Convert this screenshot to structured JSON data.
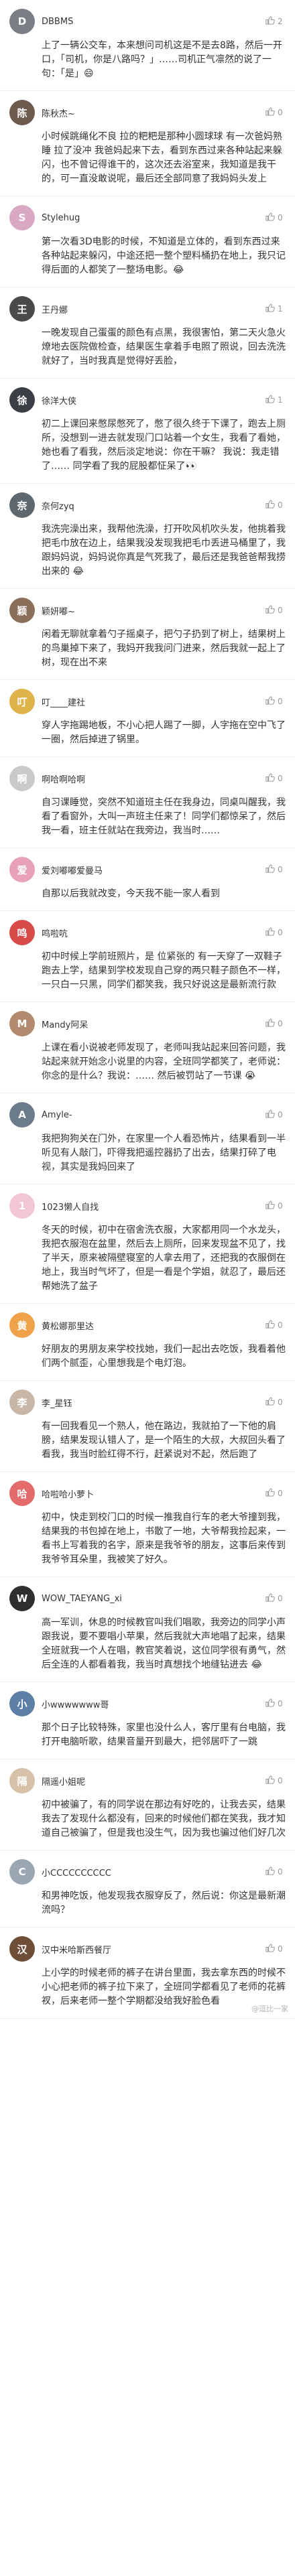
{
  "comments": [
    {
      "username": "DBBMS",
      "likes": "2",
      "avatar_color": "#7a7f86",
      "avatar_glyph": "D",
      "text": "上了一辆公交车，本来想问司机这是不是去8路，然后一开口，「司机，你是八路吗？」……司机正气凛然的说了一句：「是」😄"
    },
    {
      "username": "陈秋杰~",
      "likes": "0",
      "avatar_color": "#6d5a4c",
      "avatar_glyph": "陈",
      "text": "小时候跳绳化不良 拉的粑粑是那种小圆球球 有一次爸妈熟睡 拉了没冲 我爸妈起来下去，看到东西过来各种站起来躲闪，也不曾记得谁干的，这次还去浴室来，我知道是我干的，可一直没敢说呢，最后还全部同意了我妈妈头发上"
    },
    {
      "username": "Stylehug",
      "likes": "0",
      "avatar_color": "#d9a9c4",
      "avatar_glyph": "S",
      "text": "第一次看3D电影的时候，不知道是立体的，看到东西过来各种站起来躲闪，中途还把一整个塑料桶扔在地上，我只记得后面的人都笑了一整场电影。😂"
    },
    {
      "username": "王丹娜",
      "likes": "1",
      "avatar_color": "#4a4a4a",
      "avatar_glyph": "王",
      "text": "一晚发现自己蛋蛋的颜色有点黑，我很害怕，第二天火急火燎地去医院做检查，结果医生拿着手电照了照说，回去洗洗就好了，当时我真是觉得好丢脸，"
    },
    {
      "username": "徐洋大侠",
      "likes": "1",
      "avatar_color": "#3b3f45",
      "avatar_glyph": "徐",
      "text": "初二上课回来憋尿憋死了，憋了很久终于下课了，跑去上厕所，没想到一进去就发现门口站着一个女生，我看了看她，她也看了看我，然后淡定地说：你在干嘛？ 我说：我走错了…… 同学看了我的屁股都怔呆了👀"
    },
    {
      "username": "奈何zyq",
      "likes": "0",
      "avatar_color": "#5d6770",
      "avatar_glyph": "奈",
      "text": "我洗完澡出来，我帮他洗澡，打开吹风机吹头发，他挑着我把毛巾放在边上，结果我没发现我把毛巾丢进马桶里了，我跟妈妈说，妈妈说你真是气死我了，最后还是我爸爸帮我捞出来的 😂"
    },
    {
      "username": "颖妍嘟~",
      "likes": "0",
      "avatar_color": "#8c6f5a",
      "avatar_glyph": "颖",
      "text": "闲着无聊就拿着勺子摇桌子，把勺子扔到了树上，结果树上的鸟巢掉下来了，我妈开我我问门进来，然后我就一起上了树，现在出不来"
    },
    {
      "username": "叮____建社",
      "likes": "0",
      "avatar_color": "#e0b24a",
      "avatar_glyph": "叮",
      "text": "穿人字拖踢地板，不小心把人踢了一脚，人字拖在空中飞了一圈，然后掉进了锅里。"
    },
    {
      "username": "啊哈啊哈啊",
      "likes": "0",
      "avatar_color": "#c9c9c9",
      "avatar_glyph": "啊",
      "text": "自习课睡觉，突然不知道班主任在我身边，同桌叫醒我，我看了看窗外，大叫一声班主任来了！同学们都惊呆了，然后我一看，班主任就站在我旁边，我当时……"
    },
    {
      "username": "爱刘嘟嘟爱曼马",
      "likes": "0",
      "avatar_color": "#e8a2b8",
      "avatar_glyph": "爱",
      "text": "自那以后我就改变，今天我不能一家人看到"
    },
    {
      "username": "鸣啦吭",
      "likes": "0",
      "avatar_color": "#d84a4a",
      "avatar_glyph": "鸣",
      "text": "初中时候上学前班照片，是 位紧张的 有一天穿了一双鞋子跑去上学，结果到学校发现自己穿的两只鞋子颜色不一样，一只白一只黑，同学们都笑我，我只好说这是最新流行款"
    },
    {
      "username": "Mandy阿呆",
      "likes": "0",
      "avatar_color": "#b28b6e",
      "avatar_glyph": "M",
      "text": "上课在看小说被老师发现了，老师叫我站起来回答问题，我站起来就开始念小说里的内容，全班同学都笑了，老师说：你念的是什么？我说：…… 然后被罚站了一节课 😭"
    },
    {
      "username": "Amyle-",
      "likes": "0",
      "avatar_color": "#6b7b8c",
      "avatar_glyph": "A",
      "text": "我把狗狗关在门外，在家里一个人看恐怖片，结果看到一半听见有人敲门，吓得我把遥控器扔了出去，结果打碎了电视，其实是我妈回来了"
    },
    {
      "username": "1023懒人自找",
      "likes": "0",
      "avatar_color": "#f2c6d4",
      "avatar_glyph": "1",
      "text": "冬天的时候，初中在宿舍洗衣服，大家都用同一个水龙头，我把衣服泡在盆里，然后去上厕所，回来发现盆不见了，找了半天，原来被隔壁寝室的人拿去用了，还把我的衣服倒在地上，我当时气坏了，但是一看是个学姐，就忍了，最后还帮她洗了盆子"
    },
    {
      "username": "黄松娜那里达",
      "likes": "0",
      "avatar_color": "#f0a24a",
      "avatar_glyph": "黄",
      "text": "好朋友的男朋友来学校找她，我们一起出去吃饭，我看着他们两个腻歪，心里想我是个电灯泡。"
    },
    {
      "username": "李_星钰",
      "likes": "0",
      "avatar_color": "#c8b7a6",
      "avatar_glyph": "李",
      "text": "有一回我看见一个熟人，他在路边，我就拍了一下他的肩膀，结果发现认错人了，是一个陌生的大叔，大叔回头看了看我，我当时脸红得不行，赶紧说对不起，然后跑了"
    },
    {
      "username": "哈啦哈小萝卜",
      "likes": "0",
      "avatar_color": "#e36b6b",
      "avatar_glyph": "哈",
      "text": "初中，快走到校门口的时候一推我自行车的老大爷撞到我，结果我的书包掉在地上，书散了一地，大爷帮我捡起来，一看书上写着我的名字，原来是我爷爷的朋友，这事后来传到我爷爷耳朵里，我被笑了好久。"
    },
    {
      "username": "WOW_TAEYANG_xi",
      "likes": "0",
      "avatar_color": "#2f2f2f",
      "avatar_glyph": "W",
      "text": "高一军训，休息的时候教官叫我们唱歌，我旁边的同学小声跟我说，要不要唱小苹果，然后我就大声地唱了起来，结果全班就我一个人在唱，教官笑着说，这位同学很有勇气，然后全连的人都看着我，我当时真想找个地缝钻进去 😂"
    },
    {
      "username": "小wwwwwww哥",
      "likes": "0",
      "avatar_color": "#5b7fa6",
      "avatar_glyph": "小",
      "text": "那个日子比较特殊，家里也没什么人，客厅里有台电脑，我打开电脑听歌，结果音量开到最大，把邻居吓了一跳"
    },
    {
      "username": "隔遥小姐呢",
      "likes": "0",
      "avatar_color": "#d7c1a8",
      "avatar_glyph": "隔",
      "text": "初中被骗了，有的同学说在那边有好吃的，让我去买，结果我去了发现什么都没有，回来的时候他们都在笑我，我才知道自己被骗了，但是我也没生气，因为我也骗过他们好几次"
    },
    {
      "username": "小CCCCCCCCCC",
      "likes": "0",
      "avatar_color": "#9aa7b3",
      "avatar_glyph": "C",
      "text": "和男神吃饭，他发现我衣服穿反了，然后说：你这是最新潮流吗？"
    },
    {
      "username": "汉中米哈斯西餐厅",
      "likes": "0",
      "avatar_color": "#6f4e37",
      "avatar_glyph": "汉",
      "text": "上小学的时候老师的裤子在讲台里面，我去拿东西的时候不小心把老师的裤子拉下来了，全班同学都看见了老师的花裤衩，后来老师一整个学期都没给我好脸色看"
    }
  ],
  "watermark": "@逗比一家"
}
